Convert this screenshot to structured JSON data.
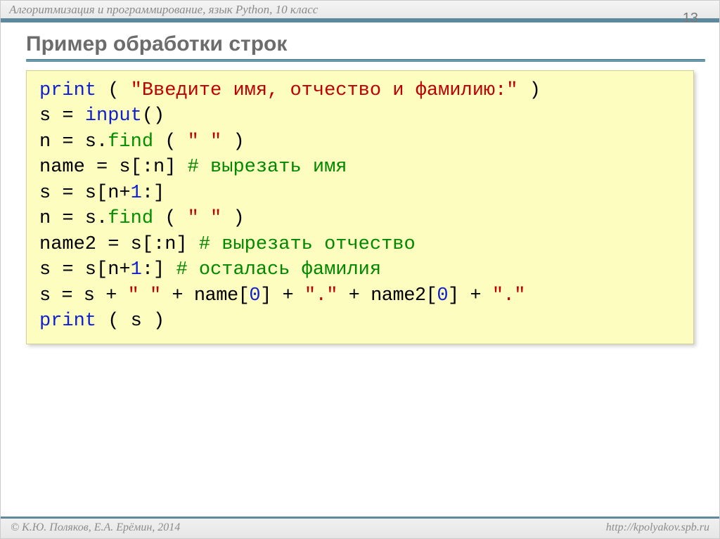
{
  "header": {
    "subject": "Алгоритмизация и программирование, язык Python, 10 класс"
  },
  "page_number": "13",
  "title": "Пример обработки строк",
  "code": {
    "l1_kw": "print",
    "l1_par1": " ( ",
    "l1_str": "\"Введите имя, отчество и фамилию:\"",
    "l1_par2": " )",
    "l2a": "s = ",
    "l2b": "input",
    "l2c": "()",
    "l3a": "n = s.",
    "l3b": "find",
    "l3c": " ( ",
    "l3d": "\" \"",
    "l3e": " )",
    "l4a": "name = s[:n]    ",
    "l4c": "# вырезать имя",
    "l5a": "s = s[n+",
    "l5b": "1",
    "l5c": ":]",
    "l6a": "n = s.",
    "l6b": "find",
    "l6c": " ( ",
    "l6d": "\" \"",
    "l6e": " )",
    "l7a": "name2 = s[:n]       ",
    "l7c": "# вырезать отчество",
    "l8a": "s = s[n+",
    "l8b": "1",
    "l8c": ":]          ",
    "l8d": "# осталась фамилия",
    "l9a": "s = s + ",
    "l9b": "\" \"",
    "l9c": " + name[",
    "l9d": "0",
    "l9e": "] + ",
    "l9f": "\".\"",
    "l9g": " + name2[",
    "l9h": "0",
    "l9i": "] + ",
    "l9j": "\".\"",
    "l10a": "print",
    "l10b": " ( s )"
  },
  "footer": {
    "left": "© К.Ю. Поляков, Е.А. Ерёмин, 2014",
    "right": "http://kpolyakov.spb.ru"
  }
}
